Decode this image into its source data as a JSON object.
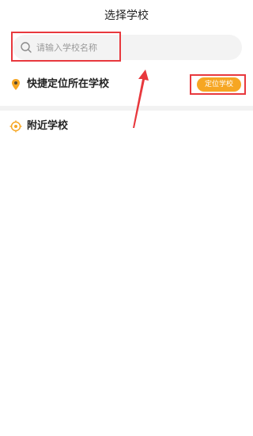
{
  "header": {
    "title": "选择学校"
  },
  "search": {
    "placeholder": "请输入学校名称",
    "value": ""
  },
  "quick_locate": {
    "label": "快捷定位所在学校",
    "button_label": "定位学校"
  },
  "nearby": {
    "label": "附近学校"
  },
  "colors": {
    "accent": "#f6a623",
    "highlight": "#e8383d",
    "icon_orange": "#f6a623"
  },
  "icons": {
    "search": "search-icon",
    "location_pin": "location-pin-icon",
    "nearby": "nearby-target-icon"
  }
}
